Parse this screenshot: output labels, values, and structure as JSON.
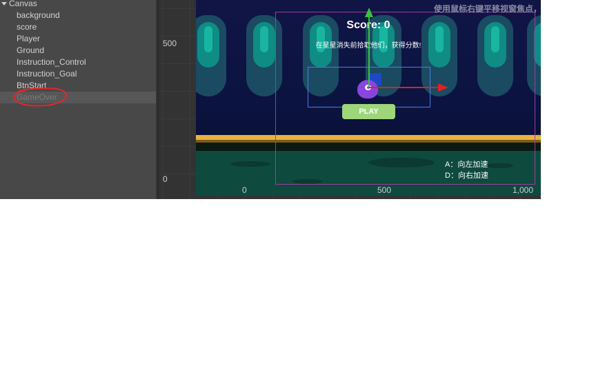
{
  "hierarchy": {
    "root": "Canvas",
    "items": [
      "background",
      "score",
      "Player",
      "Ground",
      "Instruction_Control",
      "Instruction_Goal",
      "BtnStart",
      "GameOver"
    ]
  },
  "scene": {
    "hint": "使用鼠标右键平移视窗焦点，使用滚轮",
    "y_axis": [
      "500",
      "0"
    ],
    "x_axis": [
      "0",
      "500",
      "1,000"
    ],
    "score": "Score: 0",
    "goal": "在星星消失前拾取他们，获得分数!",
    "play": "PLAY",
    "control_a": "A：向左加速",
    "control_d": "D：向右加速"
  },
  "colors": {
    "accent_green": "#9ed67a",
    "gizmo_x": "#e22020",
    "gizmo_y": "#37c33b",
    "selection": "#4a7fe0",
    "canvas_frame": "#a03aa0"
  }
}
